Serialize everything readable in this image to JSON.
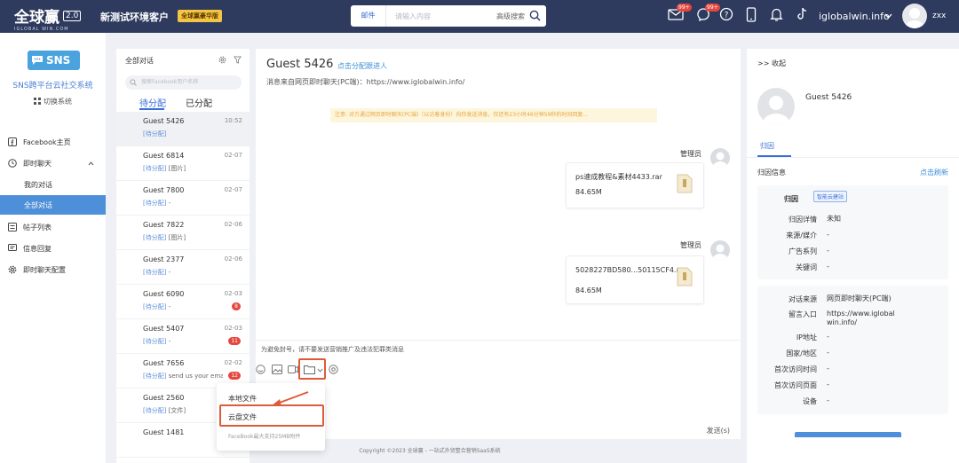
{
  "topbar": {
    "logo_main": "全球赢",
    "logo_version": "2.0",
    "logo_sub": "IGLOBAL WIN.COM",
    "org_name": "新测试环境客户",
    "edition_badge": "全球赢豪华版",
    "search_tab": "邮件",
    "search_placeholder": "请输入内容",
    "search_advanced": "高级搜索",
    "mail_badge": "99+",
    "chat_badge": "99+",
    "site": "iglobalwin.info",
    "username": "zxx"
  },
  "sidebar": {
    "sns_logo": "SNS",
    "title": "SNS跨平台云社交系统",
    "switch_label": "切换系统",
    "items": [
      {
        "label": "Facebook主页",
        "icon": "facebook-icon"
      },
      {
        "label": "即时聊天",
        "icon": "chat-clock-icon"
      },
      {
        "label": "我的对话"
      },
      {
        "label": "全部对话"
      },
      {
        "label": "帖子列表",
        "icon": "post-list-icon"
      },
      {
        "label": "信息回复",
        "icon": "reply-icon"
      },
      {
        "label": "即时聊天配置",
        "icon": "gear-icon"
      }
    ]
  },
  "chat_list": {
    "title": "全部对话",
    "search_placeholder": "搜索Facebook用户名称",
    "tab_pending": "待分配",
    "tab_assigned": "已分配",
    "conversations": [
      {
        "name": "Guest 5426",
        "time": "10:52",
        "status": "[待分配]",
        "preview": "",
        "badge": ""
      },
      {
        "name": "Guest 6814",
        "time": "02-07",
        "status": "[待分配]",
        "preview": "[图片]",
        "badge": ""
      },
      {
        "name": "Guest 7800",
        "time": "02-07",
        "status": "[待分配]",
        "preview": "-",
        "badge": ""
      },
      {
        "name": "Guest 7822",
        "time": "02-06",
        "status": "[待分配]",
        "preview": "[图片]",
        "badge": ""
      },
      {
        "name": "Guest 2377",
        "time": "02-06",
        "status": "[待分配]",
        "preview": "-",
        "badge": ""
      },
      {
        "name": "Guest 6090",
        "time": "02-03",
        "status": "[待分配]",
        "preview": "-",
        "badge": "8"
      },
      {
        "name": "Guest 5407",
        "time": "02-03",
        "status": "[待分配]",
        "preview": "-",
        "badge": "11"
      },
      {
        "name": "Guest 7656",
        "time": "02-02",
        "status": "[待分配]",
        "preview": "send us your ema...",
        "badge": "12"
      },
      {
        "name": "Guest 2560",
        "time": "",
        "status": "[待分配]",
        "preview": "[文件]",
        "badge": ""
      },
      {
        "name": "Guest 1481",
        "time": "",
        "status": "",
        "preview": "",
        "badge": ""
      }
    ]
  },
  "main": {
    "guest_name": "Guest 5426",
    "assign_link": "点击分配跟进人",
    "source": "消息来自网页即时聊天(PC端)：https://www.iglobalwin.info/",
    "notice": "注意: 对方通过网页即时聊天(PC端)（以访客身份）向你发送消息，仅还有23小时46分钟59秒的时间回复...",
    "messages": [
      {
        "sender": "管理员",
        "file_name": "ps速成教程&素材4433.rar",
        "file_size": "84.65M"
      },
      {
        "sender": "管理员",
        "file_name": "5028227BD580...50115CF4.rar",
        "file_size": "84.65M"
      }
    ]
  },
  "composer": {
    "warning": "为避免封号，请不要发送营销推广及违法犯罪类消息",
    "send_label": "发送(s)"
  },
  "dropdown": {
    "local_file": "本地文件",
    "cloud_file": "云盘文件",
    "note": "FaceBook最大支持25MB附件"
  },
  "footer": "Copyright ©2023 全球赢 - 一站式外贸整合营销SaaS系统",
  "right_panel": {
    "collapse": ">> 收起",
    "guest_name": "Guest 5426",
    "tab": "归因",
    "section_title": "归因信息",
    "refresh": "点击刷新",
    "attribution_label": "归因",
    "attribution_tag": "智能云建站",
    "details": [
      {
        "k": "归因详情",
        "v": "未知"
      },
      {
        "k": "来源/媒介",
        "v": "-"
      },
      {
        "k": "广告系列",
        "v": "-"
      },
      {
        "k": "关键词",
        "v": "-"
      }
    ],
    "visit": [
      {
        "k": "对话来源",
        "v": "网页即时聊天(PC端)"
      },
      {
        "k": "留言入口",
        "v": "https://www.iglobalwin.info/"
      },
      {
        "k": "IP地址",
        "v": "-"
      },
      {
        "k": "国家/地区",
        "v": "-"
      },
      {
        "k": "首次访问时间",
        "v": "-"
      },
      {
        "k": "首次访问页面",
        "v": "-"
      },
      {
        "k": "设备",
        "v": "-"
      }
    ]
  },
  "colors": {
    "topbar": "#2e3b5e",
    "accent": "#4d8fd8",
    "alert": "#e05a3a",
    "badge": "#e5473f",
    "gold": "#f5c542"
  }
}
